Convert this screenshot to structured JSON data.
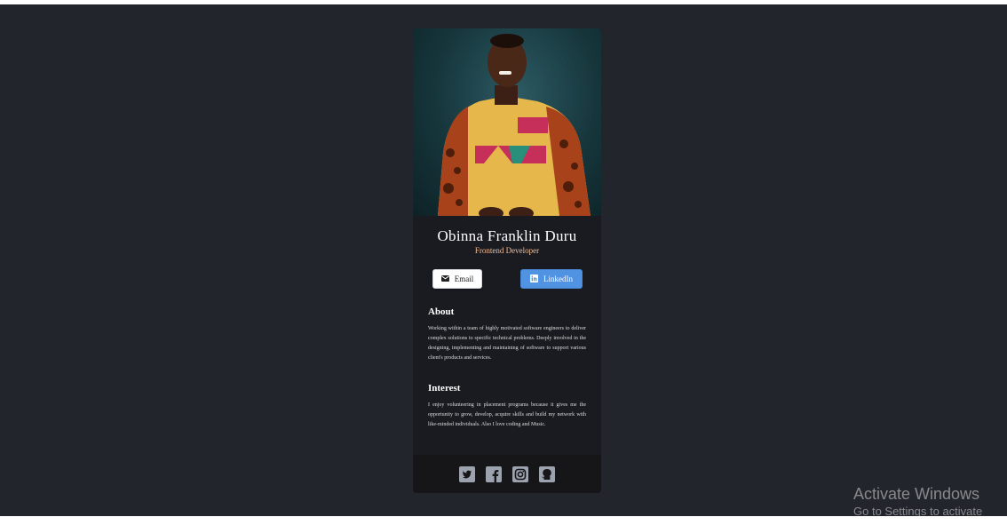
{
  "profile": {
    "name": "Obinna Franklin Duru",
    "role": "Frontend Developer"
  },
  "buttons": {
    "email_label": "Email",
    "linkedin_label": "LinkedIn"
  },
  "about": {
    "title": "About",
    "text": "Working within a team of highly motivated software engineers to deliver complex solutions to specific technical problems. Deeply involved in the designing, implementing and maintaining of software to support various client's products and services."
  },
  "interest": {
    "title": "Interest",
    "text": "I enjoy volunteering in placement programs because it gives me the opportunity to grow, develop, acquire skills and build my network with like-minded individuals. Also I love coding and Music."
  },
  "social_icons": [
    "twitter-icon",
    "facebook-icon",
    "instagram-icon",
    "github-icon"
  ],
  "watermark": {
    "title": "Activate Windows",
    "subtitle": "Go to Settings to activate"
  },
  "colors": {
    "background": "#23252c",
    "card": "#1a1b21",
    "footer": "#161619",
    "role_text": "#f3bf99",
    "linkedin_button": "#5093e2",
    "icon": "#9ca3af"
  }
}
